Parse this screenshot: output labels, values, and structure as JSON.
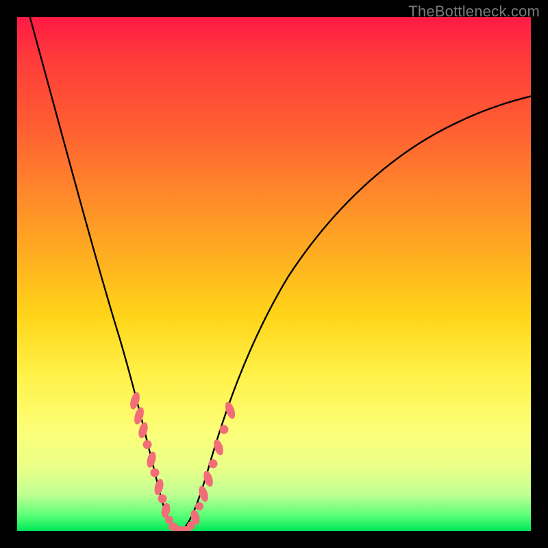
{
  "watermark": "TheBottleneck.com",
  "chart_data": {
    "type": "line",
    "title": "",
    "xlabel": "",
    "ylabel": "",
    "xlim": [
      0,
      100
    ],
    "ylim": [
      0,
      100
    ],
    "grid": false,
    "legend": false,
    "background": "radial-gradient-vertical",
    "series": [
      {
        "name": "left-branch",
        "x": [
          2,
          6,
          10,
          14,
          16,
          18,
          20,
          22,
          23,
          24,
          25,
          26,
          27,
          28
        ],
        "y": [
          100,
          82,
          65,
          48,
          39,
          30,
          22,
          15,
          11,
          8,
          5,
          3,
          1,
          0
        ]
      },
      {
        "name": "right-branch",
        "x": [
          32,
          33,
          35,
          37,
          40,
          44,
          50,
          56,
          64,
          72,
          80,
          88,
          96,
          100
        ],
        "y": [
          0,
          2,
          6,
          11,
          20,
          30,
          42,
          52,
          62,
          70,
          76,
          80,
          83,
          85
        ]
      },
      {
        "name": "left-branch-markers",
        "x": [
          21.5,
          22.5,
          23.2,
          24.0,
          24.8,
          25.6,
          26.4,
          27.2,
          28.0,
          28.8,
          29.6,
          30.4
        ],
        "y": [
          22,
          18,
          15,
          12,
          9,
          7,
          5,
          3.5,
          2,
          1,
          0.4,
          0
        ]
      },
      {
        "name": "right-branch-markers",
        "x": [
          31.2,
          31.8,
          32.4,
          33.0,
          33.8,
          34.6,
          35.5,
          36.4,
          37.4,
          38.4
        ],
        "y": [
          0,
          0.5,
          1.5,
          3,
          5,
          8,
          11,
          15,
          19,
          24
        ]
      }
    ],
    "notes": "V-shaped curve on rainbow gradient; vertex near x≈30 at y=0. Values estimated from pixels; no axis ticks present."
  },
  "colors": {
    "frame": "#000000",
    "curve": "#000000",
    "marker_fill": "#f26d78",
    "marker_stroke": "#f26d78"
  }
}
